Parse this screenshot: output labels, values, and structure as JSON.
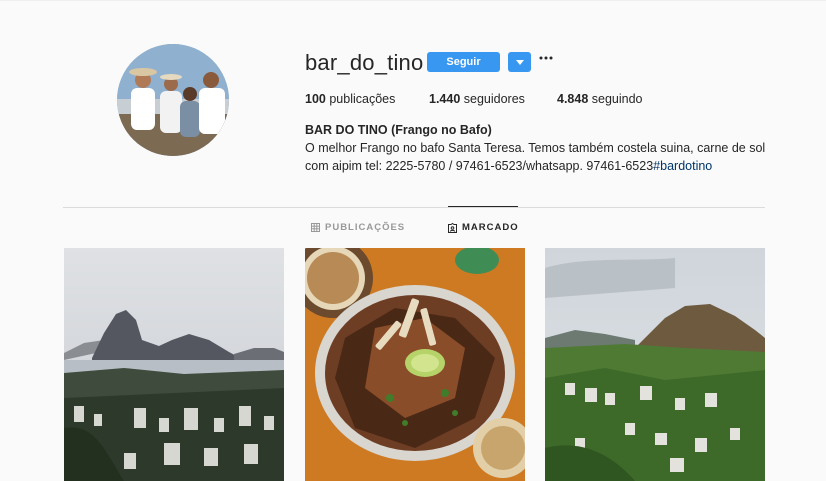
{
  "profile": {
    "username": "bar_do_tino",
    "follow_label": "Seguir",
    "stats": {
      "posts_count": "100",
      "posts_label": "publicações",
      "followers_count": "1.440",
      "followers_label": "seguidores",
      "following_count": "4.848",
      "following_label": "seguindo"
    },
    "full_name": "BAR DO TINO (Frango no Bafo)",
    "bio_text": "O melhor Frango no bafo Santa Teresa. Temos também costela suina, carne de sol com aipim tel: 2225-5780 / 97461-6523/whatsapp. 97461-6523",
    "bio_hashtag": "#bardotino"
  },
  "tabs": [
    {
      "label": "PUBLICAÇÕES",
      "icon": "grid-icon",
      "active": false
    },
    {
      "label": "MARCADO",
      "icon": "tagged-icon",
      "active": true
    }
  ],
  "posts": [
    {
      "subject": "sugarloaf-mountain-view"
    },
    {
      "subject": "grilled-chicken-platter"
    },
    {
      "subject": "green-hills-neighborhood"
    }
  ],
  "colors": {
    "accent": "#3897f0",
    "text": "#262626",
    "muted": "#999999",
    "hashtag": "#003569",
    "background": "#fafafa"
  }
}
